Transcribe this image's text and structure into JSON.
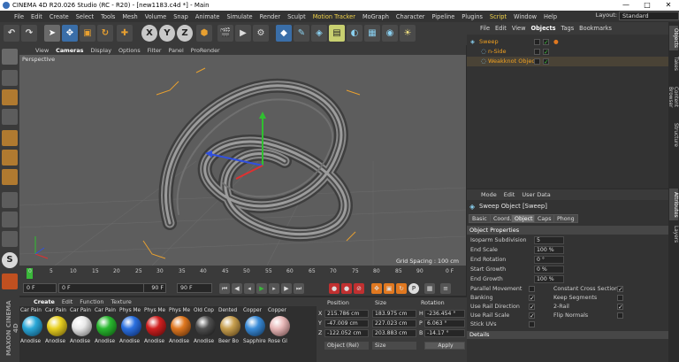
{
  "window": {
    "title": "CINEMA 4D R20.026 Studio (RC - R20) - [new1183.c4d *] - Main",
    "controls": [
      "—",
      "□",
      "✕"
    ]
  },
  "menubar": {
    "items": [
      "File",
      "Edit",
      "Create",
      "Select",
      "Tools",
      "Mesh",
      "Volume",
      "Snap",
      "Animate",
      "Simulate",
      "Render",
      "Sculpt",
      "Motion Tracker",
      "MoGraph",
      "Character",
      "Pipeline",
      "Plugins",
      "Script",
      "Window",
      "Help"
    ],
    "highlighted": [
      "Motion Tracker",
      "Script"
    ],
    "layout_label": "Layout:",
    "layout_value": "Standard"
  },
  "toolbar": {
    "icons": [
      "undo-icon",
      "redo-icon",
      "select-icon",
      "move-icon",
      "scale-icon",
      "rotate-icon",
      "create-icon",
      "x-axis-icon",
      "y-axis-icon",
      "z-axis-icon",
      "world-coord-icon",
      "render-view-icon",
      "render-picture-icon",
      "render-settings-icon",
      "cube-icon",
      "pen-icon",
      "subdivision-icon",
      "extrude-icon",
      "deformer-icon",
      "scene-icon",
      "camera-icon",
      "light-icon"
    ],
    "axis_labels": [
      "X",
      "Y",
      "Z"
    ]
  },
  "viewport": {
    "menu": [
      "View",
      "Cameras",
      "Display",
      "Options",
      "Filter",
      "Panel",
      "ProRender"
    ],
    "active_menu": "Cameras",
    "label": "Perspective",
    "grid_spacing": "Grid Spacing : 100 cm"
  },
  "timeline": {
    "ticks": [
      "0",
      "5",
      "10",
      "15",
      "20",
      "25",
      "30",
      "35",
      "40",
      "45",
      "50",
      "55",
      "60",
      "65",
      "70",
      "75",
      "80",
      "85",
      "90"
    ],
    "frame_end_label": "0 F",
    "start": "0 F",
    "current": "0 F",
    "end_a": "90 F",
    "end_b": "90 F"
  },
  "materials": {
    "menu": [
      "Create",
      "Edit",
      "Function",
      "Texture"
    ],
    "top_row": [
      "Car Pain",
      "Car Pain",
      "Car Pain",
      "Car Pain",
      "Phys Me",
      "Phys Me",
      "Phys Me",
      "Old Cop",
      "Dented",
      "Copper",
      "Copper"
    ],
    "bottom_row": [
      "Anodise",
      "Anodise",
      "Anodise",
      "Anodise",
      "Anodise",
      "Anodise",
      "Anodise",
      "Anodise",
      "Beer Bo",
      "Sapphire",
      "Rose Gl"
    ],
    "colors": [
      "#2aa8d8",
      "#e8d020",
      "#e8e8e8",
      "#2ab830",
      "#2a70e0",
      "#d02020",
      "#e07820",
      "#505050",
      "#c8a050",
      "#3a8cd8",
      "#e8b8b8"
    ]
  },
  "coordinates": {
    "headers": [
      "Position",
      "Size",
      "Rotation"
    ],
    "rows": [
      {
        "axis": "X",
        "pos": "215.786 cm",
        "size": "183.975 cm",
        "rlabel": "H",
        "rot": "-236.454 °"
      },
      {
        "axis": "Y",
        "pos": "-47.009 cm",
        "size": "227.023 cm",
        "rlabel": "P",
        "rot": "6.063 °"
      },
      {
        "axis": "Z",
        "pos": "-122.052 cm",
        "size": "203.883 cm",
        "rlabel": "B",
        "rot": "-14.17 °"
      }
    ],
    "mode_a": "Object (Rel)",
    "mode_b": "Size",
    "apply": "Apply"
  },
  "objects_panel": {
    "menu": [
      "File",
      "Edit",
      "View",
      "Objects",
      "Tags",
      "Bookmarks"
    ],
    "active_menu": "Objects",
    "items": [
      {
        "name": "Sweep",
        "indent": 0,
        "color": "#f0a020"
      },
      {
        "name": "n-Side",
        "indent": 1,
        "color": "#f0a020"
      },
      {
        "name": "Weakknot Object",
        "indent": 1,
        "color": "#f0a020"
      }
    ]
  },
  "attributes": {
    "menu": [
      "Mode",
      "Edit",
      "User Data"
    ],
    "title": "Sweep Object [Sweep]",
    "tabs": [
      "Basic",
      "Coord.",
      "Object",
      "Caps",
      "Phong"
    ],
    "active_tab": "Object",
    "section": "Object Properties",
    "fields": [
      {
        "label": "Isoparm Subdivision",
        "value": "5"
      },
      {
        "label": "End Scale",
        "value": "100 %"
      },
      {
        "label": "End Rotation",
        "value": "0 °"
      },
      {
        "label": "Start Growth",
        "value": "0 %"
      },
      {
        "label": "End Growth",
        "value": "100 %"
      }
    ],
    "checks_left": [
      {
        "label": "Parallel Movement",
        "checked": false
      },
      {
        "label": "Banking",
        "checked": true
      },
      {
        "label": "Use Rail Direction",
        "checked": true
      },
      {
        "label": "Use Rail Scale",
        "checked": true
      },
      {
        "label": "Stick UVs",
        "checked": false
      }
    ],
    "checks_right": [
      {
        "label": "Constant Cross Section",
        "checked": true
      },
      {
        "label": "Keep Segments",
        "checked": false
      },
      {
        "label": "2-Rail",
        "checked": true
      },
      {
        "label": "Flip Normals",
        "checked": false
      }
    ],
    "details": "Details"
  },
  "side_tabs": [
    "Objects",
    "Takes",
    "Content Browser",
    "Structure",
    "Attributes",
    "Layers"
  ],
  "brand": "MAXON CINEMA 4D"
}
